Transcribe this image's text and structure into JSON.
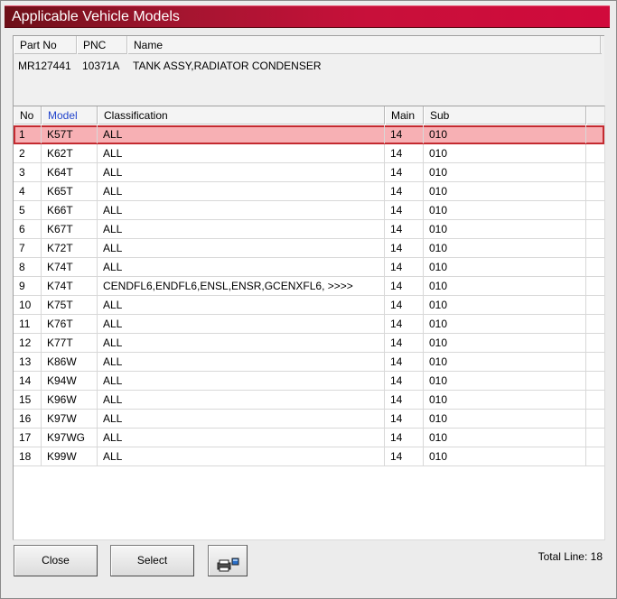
{
  "window": {
    "title": "Applicable Vehicle Models"
  },
  "part": {
    "headers": {
      "part_no": "Part No",
      "pnc": "PNC",
      "name": "Name"
    },
    "values": {
      "part_no": "MR127441",
      "pnc": "10371A",
      "name": "TANK ASSY,RADIATOR CONDENSER"
    }
  },
  "list": {
    "headers": {
      "no": "No",
      "model": "Model",
      "classification": "Classification",
      "main": "Main",
      "sub": "Sub"
    },
    "selected_row": 0,
    "rows": [
      {
        "no": "1",
        "model": "K57T",
        "classification": "ALL",
        "main": "14",
        "sub": "010"
      },
      {
        "no": "2",
        "model": "K62T",
        "classification": "ALL",
        "main": "14",
        "sub": "010"
      },
      {
        "no": "3",
        "model": "K64T",
        "classification": "ALL",
        "main": "14",
        "sub": "010"
      },
      {
        "no": "4",
        "model": "K65T",
        "classification": "ALL",
        "main": "14",
        "sub": "010"
      },
      {
        "no": "5",
        "model": "K66T",
        "classification": "ALL",
        "main": "14",
        "sub": "010"
      },
      {
        "no": "6",
        "model": "K67T",
        "classification": "ALL",
        "main": "14",
        "sub": "010"
      },
      {
        "no": "7",
        "model": "K72T",
        "classification": "ALL",
        "main": "14",
        "sub": "010"
      },
      {
        "no": "8",
        "model": "K74T",
        "classification": "ALL",
        "main": "14",
        "sub": "010"
      },
      {
        "no": "9",
        "model": "K74T",
        "classification": "CENDFL6,ENDFL6,ENSL,ENSR,GCENXFL6,  >>>>",
        "main": "14",
        "sub": "010"
      },
      {
        "no": "10",
        "model": "K75T",
        "classification": "ALL",
        "main": "14",
        "sub": "010"
      },
      {
        "no": "11",
        "model": "K76T",
        "classification": "ALL",
        "main": "14",
        "sub": "010"
      },
      {
        "no": "12",
        "model": "K77T",
        "classification": "ALL",
        "main": "14",
        "sub": "010"
      },
      {
        "no": "13",
        "model": "K86W",
        "classification": "ALL",
        "main": "14",
        "sub": "010"
      },
      {
        "no": "14",
        "model": "K94W",
        "classification": "ALL",
        "main": "14",
        "sub": "010"
      },
      {
        "no": "15",
        "model": "K96W",
        "classification": "ALL",
        "main": "14",
        "sub": "010"
      },
      {
        "no": "16",
        "model": "K97W",
        "classification": "ALL",
        "main": "14",
        "sub": "010"
      },
      {
        "no": "17",
        "model": "K97WG",
        "classification": "ALL",
        "main": "14",
        "sub": "010"
      },
      {
        "no": "18",
        "model": "K99W",
        "classification": "ALL",
        "main": "14",
        "sub": "010"
      }
    ]
  },
  "footer": {
    "close_label": "Close",
    "select_label": "Select",
    "print_icon": "printer-icon",
    "total_line": "Total Line: 18"
  },
  "colors": {
    "title_bar": "#c8103a",
    "selected_row_bg": "#f7b0b4",
    "selected_row_border": "#c42a30",
    "sorted_header_text": "#2244cc"
  }
}
